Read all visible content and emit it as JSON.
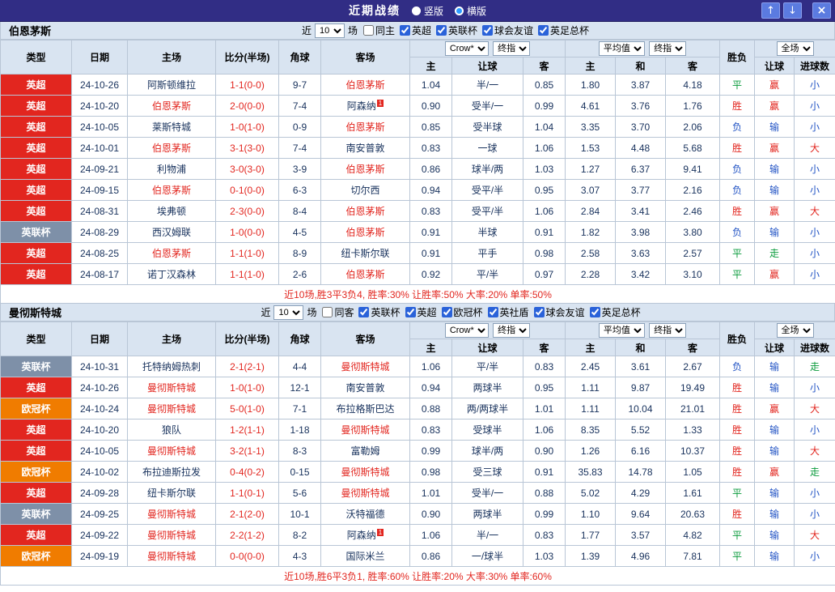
{
  "titlebar": {
    "title": "近期战绩",
    "radios": [
      {
        "label": "竖版",
        "selected": false
      },
      {
        "label": "横版",
        "selected": true
      }
    ],
    "buttons": {
      "up": "↑",
      "down": "↓",
      "close": "×"
    }
  },
  "table_header": {
    "type": "类型",
    "date": "日期",
    "home": "主场",
    "score": "比分(半场)",
    "corner": "角球",
    "away": "客场",
    "handicap_company": "Crow*",
    "handicap_time": "终指",
    "h_home": "主",
    "h_line": "让球",
    "h_away": "客",
    "europe_company": "平均值",
    "europe_time": "终指",
    "e_home": "主",
    "e_draw": "和",
    "e_away": "客",
    "result": "胜负",
    "full": "全场",
    "f_handicap": "让球",
    "f_goals": "进球数"
  },
  "colors": {
    "league": {
      "英超": "#e2261f",
      "英联杯": "#7e90a8",
      "欧冠杯": "#f07c00"
    },
    "result": {
      "胜": "#e2261f",
      "平": "#0a9b3c",
      "负": "#2153c4"
    },
    "handicap": {
      "赢": "#e2261f",
      "走": "#0a9b3c",
      "输": "#2153c4"
    },
    "goals": {
      "大": "#e2261f",
      "走": "#0a9b3c",
      "小": "#2153c4"
    },
    "subject": "#e2261f",
    "score": "#e2261f",
    "text": "#17315c",
    "titlebar_bg": "#312d85",
    "header_bg": "#d9e4f1"
  },
  "sections": [
    {
      "team": "伯恩茅斯",
      "filter": {
        "near": "近",
        "count": "10",
        "games": "场",
        "same": {
          "label": "同主",
          "checked": false
        },
        "leagues": [
          {
            "label": "英超",
            "checked": true
          },
          {
            "label": "英联杯",
            "checked": true
          },
          {
            "label": "球会友谊",
            "checked": true
          },
          {
            "label": "英足总杯",
            "checked": true
          }
        ]
      },
      "rows": [
        {
          "league": "英超",
          "date": "24-10-26",
          "home": "阿斯顿维拉",
          "homeSubject": false,
          "score": "1-1(0-0)",
          "corner": "9-7",
          "away": "伯恩茅斯",
          "awaySubject": true,
          "hcHome": "1.04",
          "hcLine": "半/一",
          "hcAway": "0.85",
          "euHome": "1.80",
          "euDraw": "3.87",
          "euAway": "4.18",
          "result": "平",
          "hcResult": "赢",
          "goals": "小"
        },
        {
          "league": "英超",
          "date": "24-10-20",
          "home": "伯恩茅斯",
          "homeSubject": true,
          "score": "2-0(0-0)",
          "corner": "7-4",
          "away": "阿森纳",
          "awaySubject": false,
          "awayBadge": "1",
          "hcHome": "0.90",
          "hcLine": "受半/一",
          "hcAway": "0.99",
          "euHome": "4.61",
          "euDraw": "3.76",
          "euAway": "1.76",
          "result": "胜",
          "hcResult": "赢",
          "goals": "小"
        },
        {
          "league": "英超",
          "date": "24-10-05",
          "home": "莱斯特城",
          "homeSubject": false,
          "score": "1-0(1-0)",
          "corner": "0-9",
          "away": "伯恩茅斯",
          "awaySubject": true,
          "hcHome": "0.85",
          "hcLine": "受半球",
          "hcAway": "1.04",
          "euHome": "3.35",
          "euDraw": "3.70",
          "euAway": "2.06",
          "result": "负",
          "hcResult": "输",
          "goals": "小"
        },
        {
          "league": "英超",
          "date": "24-10-01",
          "home": "伯恩茅斯",
          "homeSubject": true,
          "score": "3-1(3-0)",
          "corner": "7-4",
          "away": "南安普敦",
          "awaySubject": false,
          "hcHome": "0.83",
          "hcLine": "一球",
          "hcAway": "1.06",
          "euHome": "1.53",
          "euDraw": "4.48",
          "euAway": "5.68",
          "result": "胜",
          "hcResult": "赢",
          "goals": "大"
        },
        {
          "league": "英超",
          "date": "24-09-21",
          "home": "利物浦",
          "homeSubject": false,
          "score": "3-0(3-0)",
          "corner": "3-9",
          "away": "伯恩茅斯",
          "awaySubject": true,
          "hcHome": "0.86",
          "hcLine": "球半/两",
          "hcAway": "1.03",
          "euHome": "1.27",
          "euDraw": "6.37",
          "euAway": "9.41",
          "result": "负",
          "hcResult": "输",
          "goals": "小"
        },
        {
          "league": "英超",
          "date": "24-09-15",
          "home": "伯恩茅斯",
          "homeSubject": true,
          "score": "0-1(0-0)",
          "corner": "6-3",
          "away": "切尔西",
          "awaySubject": false,
          "hcHome": "0.94",
          "hcLine": "受平/半",
          "hcAway": "0.95",
          "euHome": "3.07",
          "euDraw": "3.77",
          "euAway": "2.16",
          "result": "负",
          "hcResult": "输",
          "goals": "小"
        },
        {
          "league": "英超",
          "date": "24-08-31",
          "home": "埃弗顿",
          "homeSubject": false,
          "score": "2-3(0-0)",
          "corner": "8-4",
          "away": "伯恩茅斯",
          "awaySubject": true,
          "hcHome": "0.83",
          "hcLine": "受平/半",
          "hcAway": "1.06",
          "euHome": "2.84",
          "euDraw": "3.41",
          "euAway": "2.46",
          "result": "胜",
          "hcResult": "赢",
          "goals": "大"
        },
        {
          "league": "英联杯",
          "date": "24-08-29",
          "home": "西汉姆联",
          "homeSubject": false,
          "score": "1-0(0-0)",
          "corner": "4-5",
          "away": "伯恩茅斯",
          "awaySubject": true,
          "hcHome": "0.91",
          "hcLine": "半球",
          "hcAway": "0.91",
          "euHome": "1.82",
          "euDraw": "3.98",
          "euAway": "3.80",
          "result": "负",
          "hcResult": "输",
          "goals": "小"
        },
        {
          "league": "英超",
          "date": "24-08-25",
          "home": "伯恩茅斯",
          "homeSubject": true,
          "score": "1-1(1-0)",
          "corner": "8-9",
          "away": "纽卡斯尔联",
          "awaySubject": false,
          "hcHome": "0.91",
          "hcLine": "平手",
          "hcAway": "0.98",
          "euHome": "2.58",
          "euDraw": "3.63",
          "euAway": "2.57",
          "result": "平",
          "hcResult": "走",
          "goals": "小"
        },
        {
          "league": "英超",
          "date": "24-08-17",
          "home": "诺丁汉森林",
          "homeSubject": false,
          "score": "1-1(1-0)",
          "corner": "2-6",
          "away": "伯恩茅斯",
          "awaySubject": true,
          "hcHome": "0.92",
          "hcLine": "平/半",
          "hcAway": "0.97",
          "euHome": "2.28",
          "euDraw": "3.42",
          "euAway": "3.10",
          "result": "平",
          "hcResult": "赢",
          "goals": "小"
        }
      ],
      "summary": "近10场,胜3平3负4, 胜率:30% 让胜率:50% 大率:20% 单率:50%"
    },
    {
      "team": "曼彻斯特城",
      "filter": {
        "near": "近",
        "count": "10",
        "games": "场",
        "same": {
          "label": "同客",
          "checked": false
        },
        "leagues": [
          {
            "label": "英联杯",
            "checked": true
          },
          {
            "label": "英超",
            "checked": true
          },
          {
            "label": "欧冠杯",
            "checked": true
          },
          {
            "label": "英社盾",
            "checked": true
          },
          {
            "label": "球会友谊",
            "checked": true
          },
          {
            "label": "英足总杯",
            "checked": true
          }
        ]
      },
      "rows": [
        {
          "league": "英联杯",
          "date": "24-10-31",
          "home": "托特纳姆热刺",
          "homeSubject": false,
          "score": "2-1(2-1)",
          "corner": "4-4",
          "away": "曼彻斯特城",
          "awaySubject": true,
          "hcHome": "1.06",
          "hcLine": "平/半",
          "hcAway": "0.83",
          "euHome": "2.45",
          "euDraw": "3.61",
          "euAway": "2.67",
          "result": "负",
          "hcResult": "输",
          "goals": "走"
        },
        {
          "league": "英超",
          "date": "24-10-26",
          "home": "曼彻斯特城",
          "homeSubject": true,
          "score": "1-0(1-0)",
          "corner": "12-1",
          "away": "南安普敦",
          "awaySubject": false,
          "hcHome": "0.94",
          "hcLine": "两球半",
          "hcAway": "0.95",
          "euHome": "1.11",
          "euDraw": "9.87",
          "euAway": "19.49",
          "result": "胜",
          "hcResult": "输",
          "goals": "小"
        },
        {
          "league": "欧冠杯",
          "date": "24-10-24",
          "home": "曼彻斯特城",
          "homeSubject": true,
          "score": "5-0(1-0)",
          "corner": "7-1",
          "away": "布拉格斯巴达",
          "awaySubject": false,
          "hcHome": "0.88",
          "hcLine": "两/两球半",
          "hcAway": "1.01",
          "euHome": "1.11",
          "euDraw": "10.04",
          "euAway": "21.01",
          "result": "胜",
          "hcResult": "赢",
          "goals": "大"
        },
        {
          "league": "英超",
          "date": "24-10-20",
          "home": "狼队",
          "homeSubject": false,
          "score": "1-2(1-1)",
          "corner": "1-18",
          "away": "曼彻斯特城",
          "awaySubject": true,
          "hcHome": "0.83",
          "hcLine": "受球半",
          "hcAway": "1.06",
          "euHome": "8.35",
          "euDraw": "5.52",
          "euAway": "1.33",
          "result": "胜",
          "hcResult": "输",
          "goals": "小"
        },
        {
          "league": "英超",
          "date": "24-10-05",
          "home": "曼彻斯特城",
          "homeSubject": true,
          "score": "3-2(1-1)",
          "corner": "8-3",
          "away": "富勒姆",
          "awaySubject": false,
          "hcHome": "0.99",
          "hcLine": "球半/两",
          "hcAway": "0.90",
          "euHome": "1.26",
          "euDraw": "6.16",
          "euAway": "10.37",
          "result": "胜",
          "hcResult": "输",
          "goals": "大"
        },
        {
          "league": "欧冠杯",
          "date": "24-10-02",
          "home": "布拉迪斯拉发",
          "homeSubject": false,
          "score": "0-4(0-2)",
          "corner": "0-15",
          "away": "曼彻斯特城",
          "awaySubject": true,
          "hcHome": "0.98",
          "hcLine": "受三球",
          "hcAway": "0.91",
          "euHome": "35.83",
          "euDraw": "14.78",
          "euAway": "1.05",
          "result": "胜",
          "hcResult": "赢",
          "goals": "走"
        },
        {
          "league": "英超",
          "date": "24-09-28",
          "home": "纽卡斯尔联",
          "homeSubject": false,
          "score": "1-1(0-1)",
          "corner": "5-6",
          "away": "曼彻斯特城",
          "awaySubject": true,
          "hcHome": "1.01",
          "hcLine": "受半/一",
          "hcAway": "0.88",
          "euHome": "5.02",
          "euDraw": "4.29",
          "euAway": "1.61",
          "result": "平",
          "hcResult": "输",
          "goals": "小"
        },
        {
          "league": "英联杯",
          "date": "24-09-25",
          "home": "曼彻斯特城",
          "homeSubject": true,
          "score": "2-1(2-0)",
          "corner": "10-1",
          "away": "沃特福德",
          "awaySubject": false,
          "hcHome": "0.90",
          "hcLine": "两球半",
          "hcAway": "0.99",
          "euHome": "1.10",
          "euDraw": "9.64",
          "euAway": "20.63",
          "result": "胜",
          "hcResult": "输",
          "goals": "小"
        },
        {
          "league": "英超",
          "date": "24-09-22",
          "home": "曼彻斯特城",
          "homeSubject": true,
          "score": "2-2(1-2)",
          "corner": "8-2",
          "away": "阿森纳",
          "awaySubject": false,
          "awayBadge": "1",
          "hcHome": "1.06",
          "hcLine": "半/一",
          "hcAway": "0.83",
          "euHome": "1.77",
          "euDraw": "3.57",
          "euAway": "4.82",
          "result": "平",
          "hcResult": "输",
          "goals": "大"
        },
        {
          "league": "欧冠杯",
          "date": "24-09-19",
          "home": "曼彻斯特城",
          "homeSubject": true,
          "score": "0-0(0-0)",
          "corner": "4-3",
          "away": "国际米兰",
          "awaySubject": false,
          "hcHome": "0.86",
          "hcLine": "一/球半",
          "hcAway": "1.03",
          "euHome": "1.39",
          "euDraw": "4.96",
          "euAway": "7.81",
          "result": "平",
          "hcResult": "输",
          "goals": "小"
        }
      ],
      "summary": "近10场,胜6平3负1, 胜率:60% 让胜率:20% 大率:30% 单率:60%"
    }
  ]
}
